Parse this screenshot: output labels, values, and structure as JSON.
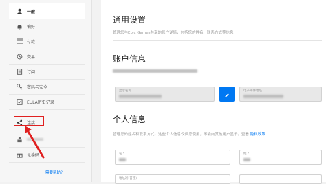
{
  "sidebar": {
    "items": [
      {
        "label": "一般",
        "icon": "user-icon",
        "active": true
      },
      {
        "label": "偏好",
        "icon": "bell-icon"
      },
      {
        "label": "付款",
        "icon": "card-icon"
      },
      {
        "label": "交易",
        "icon": "history-icon"
      },
      {
        "label": "订阅",
        "icon": "subscription-icon"
      },
      {
        "label": "密码与安全",
        "icon": "key-icon"
      },
      {
        "label": "EULA历史记录",
        "icon": "checklist-icon"
      },
      {
        "label": "连接",
        "icon": "share-icon"
      },
      {
        "label": "",
        "icon": "creator-icon"
      },
      {
        "label": "兑换码",
        "icon": "gift-icon"
      }
    ],
    "help_label": "需要帮助？"
  },
  "main": {
    "general_title": "通用设置",
    "general_desc": "管理您与Epic Games共享的账户详情，包括您的姓名、联系方式等信息",
    "account_title": "账户信息",
    "display_name_label": "显示名称",
    "email_label": "电子邮件地址",
    "personal_title": "个人信息",
    "personal_desc": "管理您的姓名和联系方式。这些个人信息仅供您使用，不会向其他用户显示。查看",
    "privacy_link": "隐私政策",
    "first_name_label": "名 *",
    "last_name_label": "姓 *",
    "address_label": "地址行(首选)"
  },
  "colors": {
    "accent": "#0078f2",
    "highlight": "#e02020"
  }
}
